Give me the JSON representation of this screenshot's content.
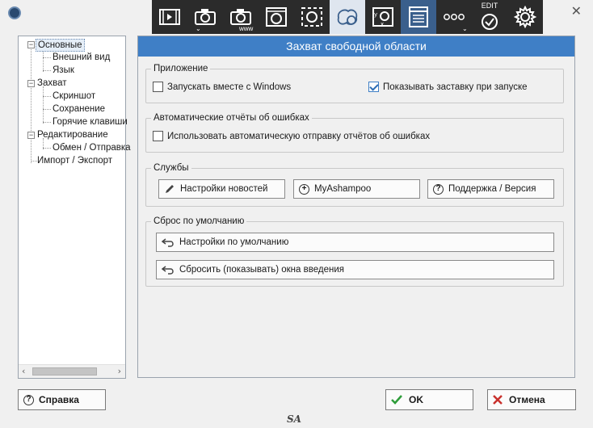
{
  "panel": {
    "title": "Захват свободной области"
  },
  "toolbar": {
    "edit_label": "EDIT",
    "www_label": "www"
  },
  "tree": {
    "items": [
      "Основные",
      "Внешний вид",
      "Язык",
      "Захват",
      "Скриншот",
      "Сохранение",
      "Горячие клавиши",
      "Редактирование",
      "Обмен / Отправка",
      "Импорт / Экспорт"
    ]
  },
  "app_group": {
    "title": "Приложение",
    "start_with_windows": {
      "label": "Запускать вместе с Windows",
      "checked": false
    },
    "show_splash": {
      "label": "Показывать заставку при запуске",
      "checked": true
    }
  },
  "error_group": {
    "title": "Автоматические отчёты об ошибках",
    "auto_send": {
      "label": "Использовать автоматическую отправку отчётов об ошибках",
      "checked": false
    }
  },
  "services_group": {
    "title": "Службы",
    "news_button": "Настройки новостей",
    "myashampoo_button": "MyAshampoo",
    "support_button": "Поддержка / Версия"
  },
  "reset_group": {
    "title": "Сброс по умолчанию",
    "defaults_button": "Настройки по умолчанию",
    "reset_intro_button": "Сбросить (показывать) окна введения"
  },
  "footer": {
    "help_button": "Справка",
    "ok_button": "OK",
    "cancel_button": "Отмена",
    "brand": "SA"
  },
  "colors": {
    "accent": "#3f7fc6",
    "toolbar_bg": "#2b2b2b"
  }
}
